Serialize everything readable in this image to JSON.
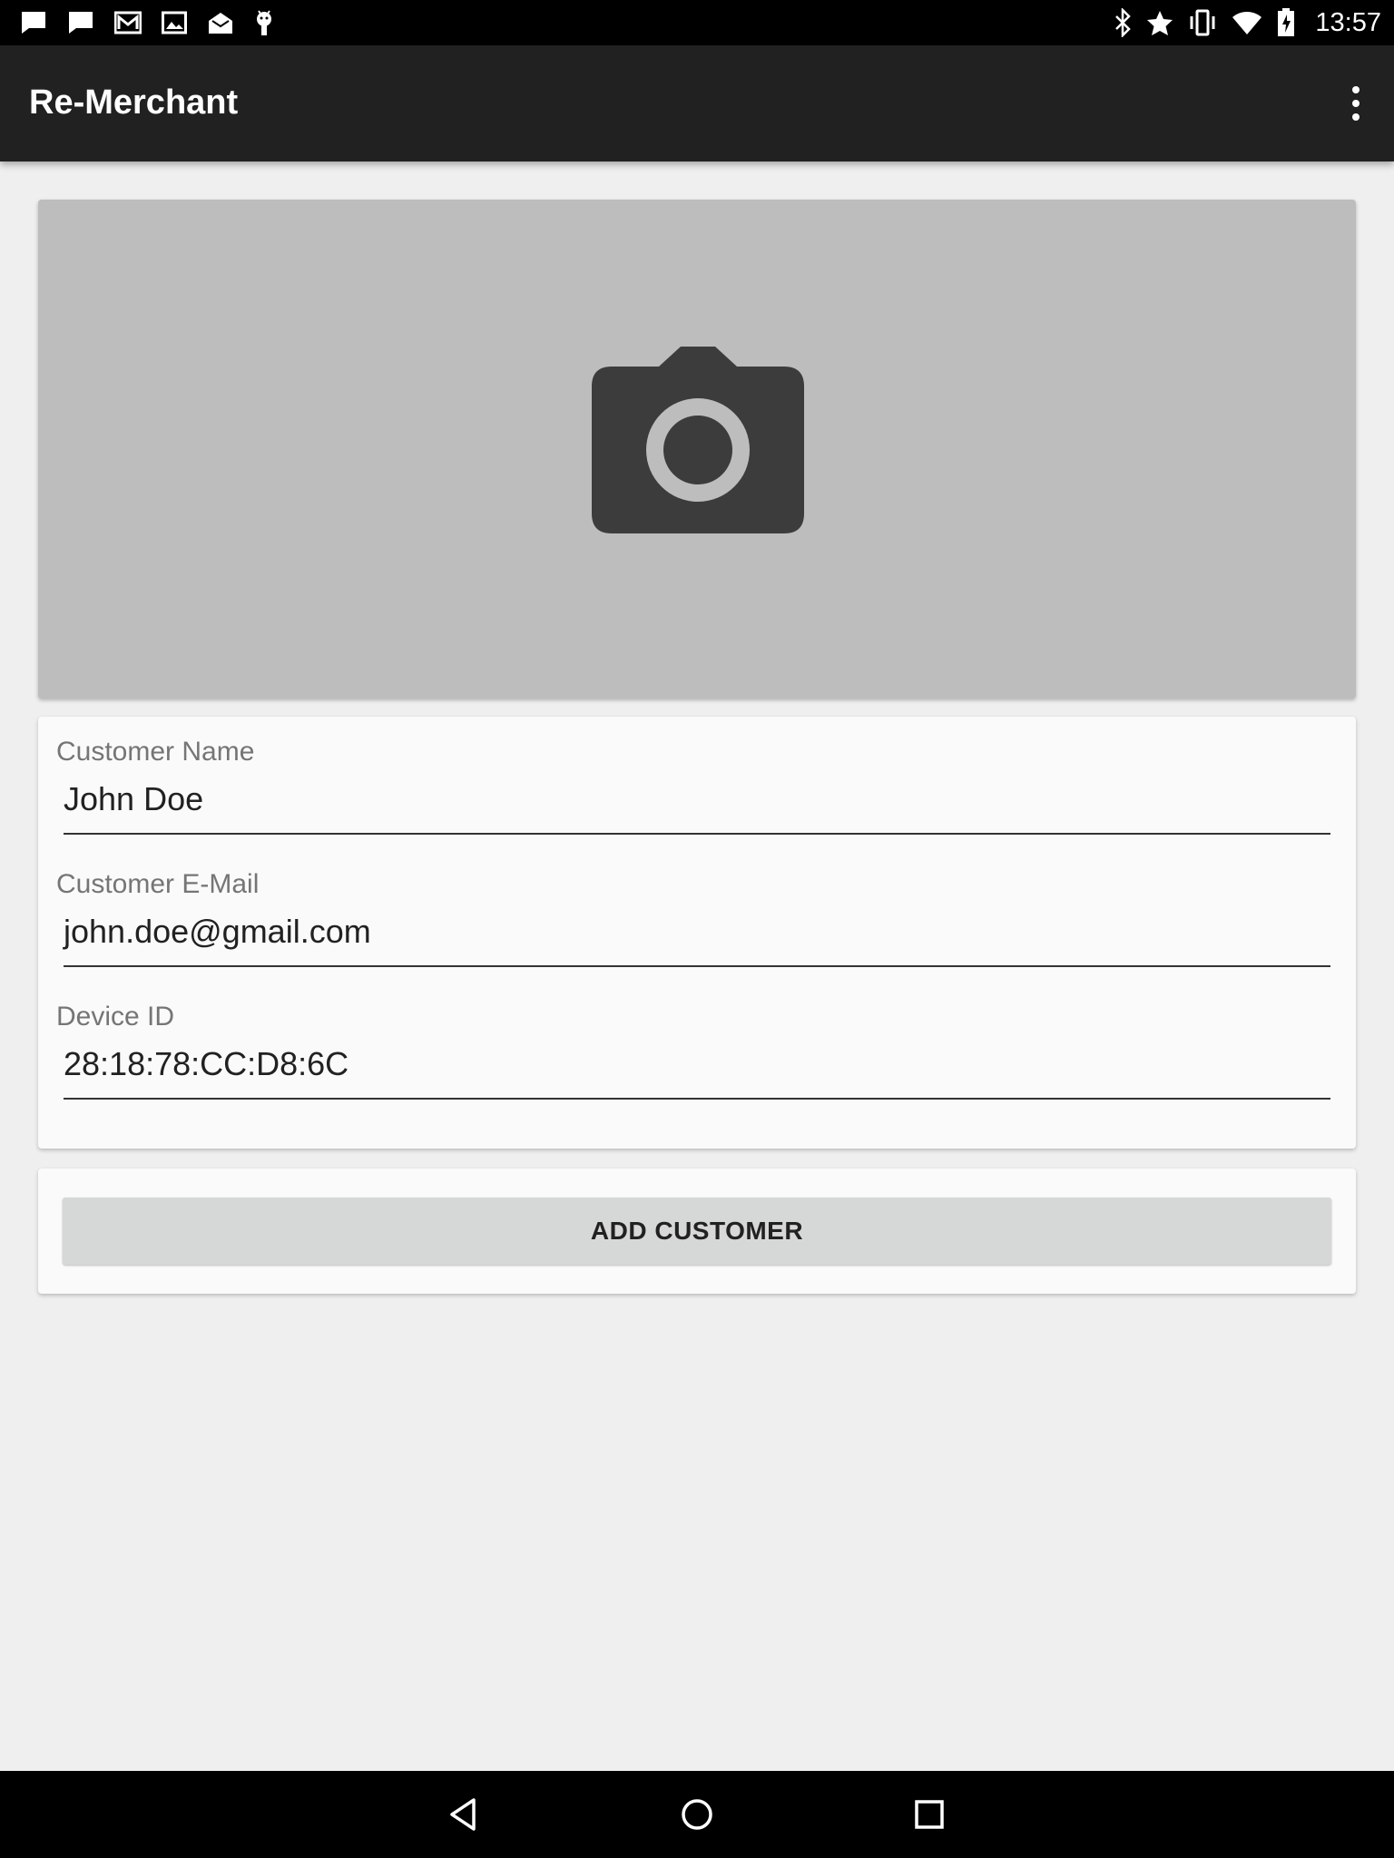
{
  "status_bar": {
    "time": "13:57",
    "left_icons": [
      "message-icon",
      "message-icon",
      "gmail-icon",
      "image-icon",
      "mail-open-icon",
      "android-icon"
    ],
    "right_icons": [
      "bluetooth-icon",
      "star-icon",
      "vibrate-icon",
      "wifi-icon",
      "battery-icon"
    ]
  },
  "app_bar": {
    "title": "Re-Merchant",
    "menu_icon": "more-vert-icon"
  },
  "photo": {
    "icon": "camera-icon",
    "background": "#bdbdbd"
  },
  "form": {
    "customer_name": {
      "label": "Customer Name",
      "value": "John Doe"
    },
    "customer_email": {
      "label": "Customer E-Mail",
      "value": "john.doe@gmail.com"
    },
    "device_id": {
      "label": "Device ID",
      "value": "28:18:78:CC:D8:6C"
    }
  },
  "actions": {
    "add_customer_label": "ADD CUSTOMER"
  },
  "nav_bar": {
    "icons": [
      "back-icon",
      "home-icon",
      "recents-icon"
    ]
  },
  "colors": {
    "app_bar": "#212121",
    "page_background": "#efefef",
    "button": "#d6d7d7"
  }
}
